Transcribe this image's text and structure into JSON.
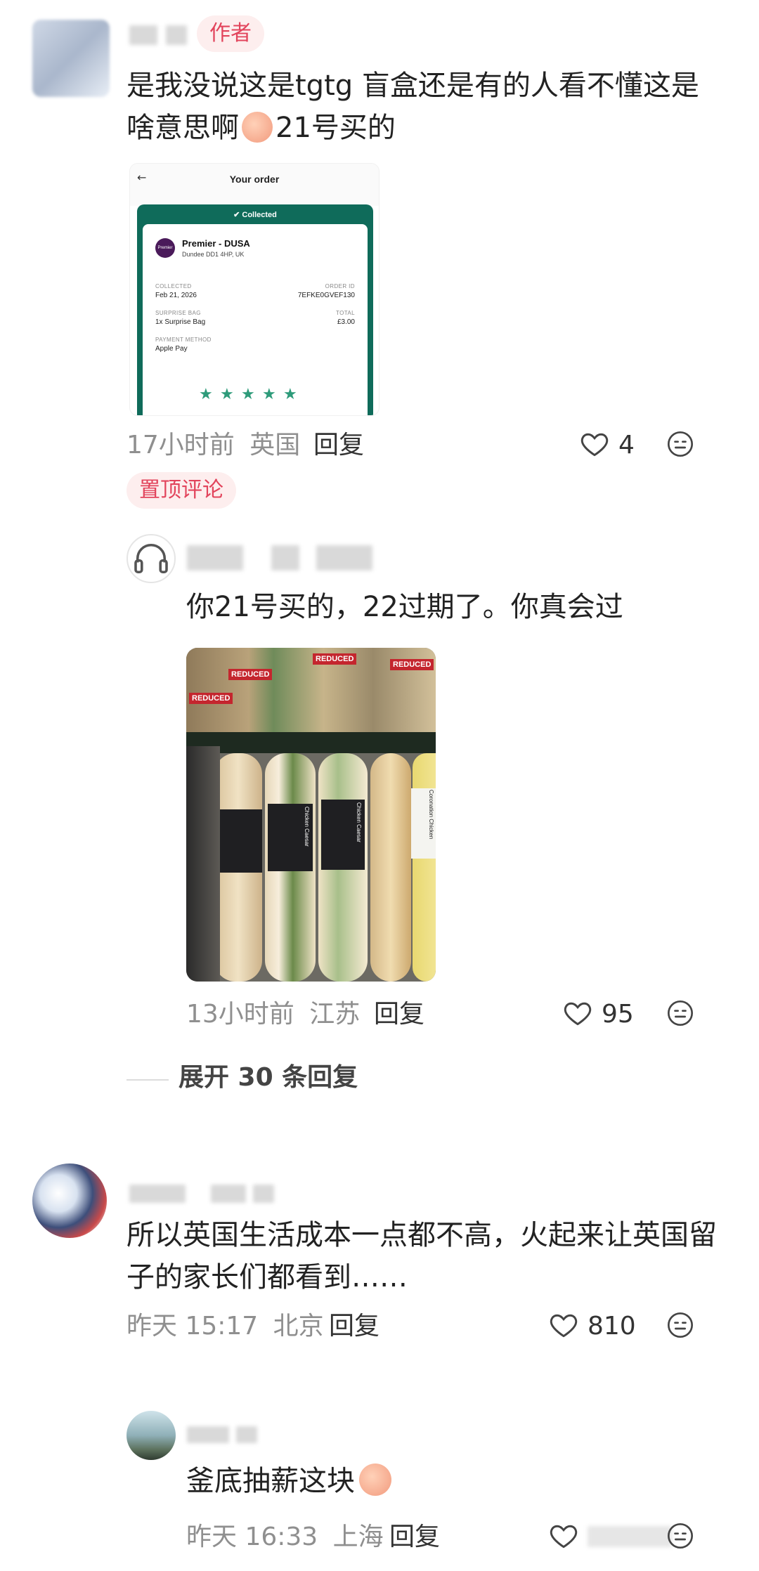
{
  "comment1": {
    "author_tag": "作者",
    "text": "是我没说这是tgtg 盲盒还是有的人看不懂这是啥意思啊",
    "text_tail": "21号买的",
    "time": "17小时前",
    "location": "英国",
    "reply": "回复",
    "likes": "4",
    "pinned_tag": "置顶评论",
    "order_card": {
      "title": "Your order",
      "status": "Collected",
      "store": "Premier - DUSA",
      "address": "Dundee DD1 4HP, UK",
      "collected_label": "COLLECTED",
      "collected_value": "Feb 21, 2026",
      "order_id_label": "ORDER ID",
      "order_id_value": "7EFKE0GVEF130",
      "bag_label": "SURPRISE BAG",
      "bag_value": "1x Surprise Bag",
      "total_label": "TOTAL",
      "total_value": "£3.00",
      "payment_label": "PAYMENT METHOD",
      "payment_value": "Apple Pay",
      "logo_text": "Premier",
      "rating_stars": 5
    }
  },
  "reply1": {
    "text": "你21号买的，22过期了。你真会过",
    "time": "13小时前",
    "location": "江苏",
    "reply": "回复",
    "likes": "95",
    "photo_labels": [
      "REDUCED",
      "REDUCED",
      "REDUCED",
      "REDUCED"
    ],
    "sandwich_labels": [
      "Chicken Caesar",
      "Chicken Caesar",
      "Coronation Chicken"
    ]
  },
  "expand": {
    "label": "展开 30 条回复"
  },
  "comment2": {
    "text": "所以英国生活成本一点都不高，火起来让英国留子的家长们都看到……",
    "time": "昨天 15:17",
    "location": "北京",
    "reply": "回复",
    "likes": "810"
  },
  "reply2": {
    "text": "釜底抽薪这块",
    "time": "昨天 16:33",
    "location": "上海",
    "reply": "回复"
  },
  "icons": {
    "like": "heart-outline-icon",
    "emoji": "face-meh-icon",
    "headphones": "headphones-icon",
    "back": "arrow-left-icon",
    "check": "check-circle-icon"
  },
  "colors": {
    "tag_bg": "#fdeeee",
    "tag_text": "#e2445c",
    "tgtg_green": "#0f6b5a",
    "star_green": "#2e9b7a"
  }
}
